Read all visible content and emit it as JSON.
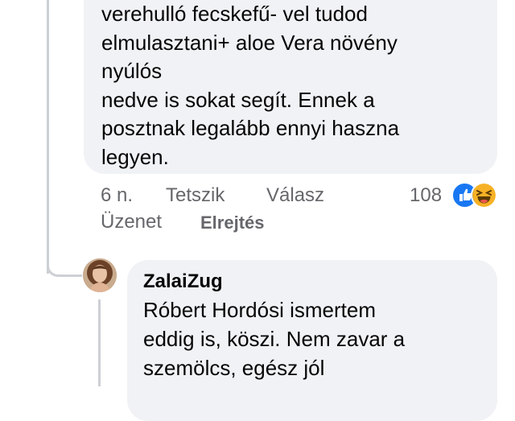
{
  "comment": {
    "lines": [
      "verehulló fecskefű- vel tudod",
      "elmulasztani+ aloe Vera növény",
      "nyúlós",
      "nedve is sokat segít. Ennek a",
      "posztnak legalább ennyi haszna",
      "legyen."
    ],
    "actions": {
      "time": "6 n.",
      "like": "Tetszik",
      "reply": "Válasz",
      "message": "Üzenet",
      "hide": "Elrejtés"
    },
    "reactions": {
      "count": "108",
      "icons": [
        "like-reaction-icon",
        "haha-reaction-icon"
      ]
    }
  },
  "reply": {
    "author": "ZalaiZug",
    "lines": [
      "Róbert Hordósi ismertem",
      "eddig is, köszi. Nem zavar a",
      "szemölcs, egész jól"
    ]
  },
  "colors": {
    "bubble": "#f0f2f5",
    "secondary_text": "#65676b",
    "like_blue": "#1877f2",
    "haha_yellow": "#f7b125"
  }
}
